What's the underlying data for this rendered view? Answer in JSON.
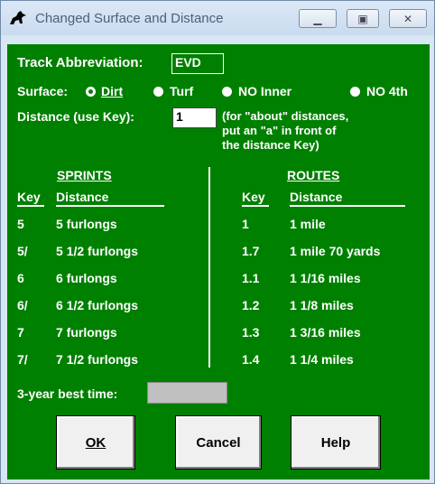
{
  "window": {
    "title": "Changed Surface and Distance"
  },
  "form": {
    "track_label": "Track Abbreviation:",
    "track_value": "EVD",
    "surface_label": "Surface:",
    "surface_options": [
      {
        "label": "Dirt",
        "selected": true
      },
      {
        "label": "Turf",
        "selected": false
      },
      {
        "label": "NO Inner",
        "selected": false
      },
      {
        "label": "NO 4th",
        "selected": false
      }
    ],
    "distance_label": "Distance (use Key):",
    "distance_value": "1",
    "distance_note": [
      "(for \"about\" distances,",
      "put an \"a\" in front of",
      "the distance Key)"
    ],
    "best_time_label": "3-year best time:",
    "best_time_value": ""
  },
  "sprints": {
    "title": "SPRINTS",
    "key_header": "Key",
    "dist_header": "Distance",
    "rows": [
      {
        "key": "5",
        "distance": "5 furlongs"
      },
      {
        "key": "5/",
        "distance": "5 1/2 furlongs"
      },
      {
        "key": "6",
        "distance": "6 furlongs"
      },
      {
        "key": "6/",
        "distance": "6 1/2 furlongs"
      },
      {
        "key": "7",
        "distance": "7 furlongs"
      },
      {
        "key": "7/",
        "distance": "7 1/2 furlongs"
      }
    ]
  },
  "routes": {
    "title": "ROUTES",
    "key_header": "Key",
    "dist_header": "Distance",
    "rows": [
      {
        "key": "1",
        "distance": "1 mile"
      },
      {
        "key": "1.7",
        "distance": "1 mile 70 yards"
      },
      {
        "key": "1.1",
        "distance": "1 1/16 miles"
      },
      {
        "key": "1.2",
        "distance": "1 1/8 miles"
      },
      {
        "key": "1.3",
        "distance": "1 3/16 miles"
      },
      {
        "key": "1.4",
        "distance": "1 1/4 miles"
      }
    ]
  },
  "buttons": {
    "ok": "OK",
    "cancel": "Cancel",
    "help": "Help"
  },
  "colors": {
    "form_bg": "#008000",
    "frame": "#d9e6f3",
    "best_time_bg": "#c0c0c0"
  }
}
